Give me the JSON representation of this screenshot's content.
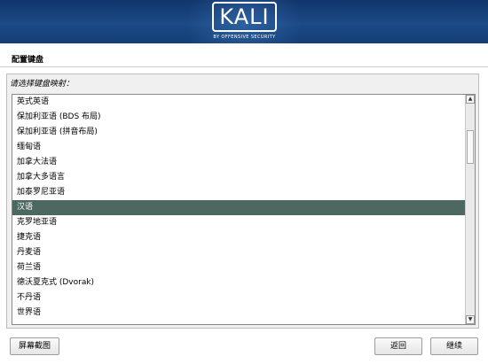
{
  "banner": {
    "logo_text": "KALI",
    "logo_subtitle": "BY OFFENSIVE SECURITY"
  },
  "page": {
    "title": "配置键盘",
    "prompt": "请选择键盘映射："
  },
  "keymap_list": {
    "items": [
      {
        "label": "英式英语",
        "selected": false
      },
      {
        "label": "保加利亚语 (BDS 布局)",
        "selected": false
      },
      {
        "label": "保加利亚语 (拼音布局)",
        "selected": false
      },
      {
        "label": "缅甸语",
        "selected": false
      },
      {
        "label": "加拿大法语",
        "selected": false
      },
      {
        "label": "加拿大多语言",
        "selected": false
      },
      {
        "label": "加泰罗尼亚语",
        "selected": false
      },
      {
        "label": "汉语",
        "selected": true
      },
      {
        "label": "克罗地亚语",
        "selected": false
      },
      {
        "label": "捷克语",
        "selected": false
      },
      {
        "label": "丹麦语",
        "selected": false
      },
      {
        "label": "荷兰语",
        "selected": false
      },
      {
        "label": "德沃夏克式 (Dvorak)",
        "selected": false
      },
      {
        "label": "不丹语",
        "selected": false
      },
      {
        "label": "世界语",
        "selected": false
      }
    ],
    "scroll_up_icon": "triangle-up",
    "scroll_down_icon": "triangle-down"
  },
  "buttons": {
    "screenshot": "屏幕截图",
    "back": "返回",
    "continue": "继续"
  },
  "colors": {
    "banner": "#1b4a86",
    "selected_row": "#4d6861"
  }
}
